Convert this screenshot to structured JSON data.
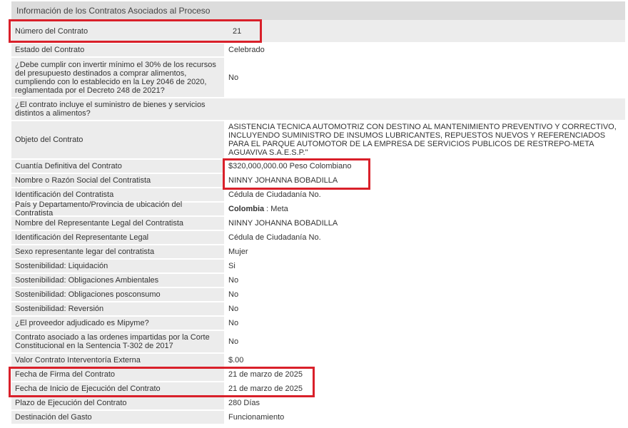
{
  "section_title": "Información de los Contratos Asociados al Proceso",
  "rows": [
    {
      "label": "Número del Contrato",
      "value": "21"
    },
    {
      "label": "Estado del Contrato",
      "value": "Celebrado"
    },
    {
      "label": "¿Debe cumplir con invertir mínimo el 30% de los recursos del presupuesto destinados a comprar alimentos, cumpliendo con lo establecido en la Ley 2046 de 2020, reglamentada por el Decreto 248 de 2021?",
      "value": "No"
    },
    {
      "label": "¿El contrato incluye el suministro de bienes y servicios distintos a alimentos?",
      "value": ""
    },
    {
      "label": "Objeto del Contrato",
      "value": "ASISTENCIA TECNICA AUTOMOTRIZ CON DESTINO AL MANTENIMIENTO PREVENTIVO Y CORRECTIVO, INCLUYENDO SUMINISTRO DE INSUMOS LUBRICANTES, REPUESTOS NUEVOS Y REFERENCIADOS PARA EL PARQUE AUTOMOTOR DE LA EMPRESA DE SERVICIOS PUBLICOS DE RESTREPO-META AGUAVIVA S.A.E.S.P.\""
    },
    {
      "label": "Cuantía Definitiva del Contrato",
      "value": "$320,000,000.00 Peso Colombiano"
    },
    {
      "label": "Nombre o Razón Social del Contratista",
      "value": "NINNY JOHANNA BOBADILLA"
    },
    {
      "label": "Identificación del Contratista",
      "value": "Cédula de Ciudadanía No."
    },
    {
      "label": "País y Departamento/Provincia de ubicación del Contratista",
      "value_bold": "Colombia",
      "value_rest": " : Meta"
    },
    {
      "label": "Nombre del Representante Legal del Contratista",
      "value": "NINNY JOHANNA BOBADILLA"
    },
    {
      "label": "Identificación del Representante Legal",
      "value": "Cédula de Ciudadanía No."
    },
    {
      "label": "Sexo representante legar del contratista",
      "value": "Mujer"
    },
    {
      "label": "Sostenibilidad: Liquidación",
      "value": "Si"
    },
    {
      "label": "Sostenibilidad: Obligaciones Ambientales",
      "value": "No"
    },
    {
      "label": "Sostenibilidad: Obligaciones posconsumo",
      "value": "No"
    },
    {
      "label": "Sostenibilidad: Reversión",
      "value": "No"
    },
    {
      "label": "¿El proveedor adjudicado es Mipyme?",
      "value": "No"
    },
    {
      "label": "Contrato asociado a las ordenes impartidas por la Corte Constitucional en la Sentencia T-302 de 2017",
      "value": "No"
    },
    {
      "label": "Valor Contrato Interventoría Externa",
      "value": "$.00"
    },
    {
      "label": "Fecha de Firma del Contrato",
      "value": "21 de marzo de 2025"
    },
    {
      "label": "Fecha de Inicio de Ejecución del Contrato",
      "value": "21 de marzo de 2025"
    },
    {
      "label": "Plazo de Ejecución del Contrato",
      "value": "280 Días"
    },
    {
      "label": "Destinación del Gasto",
      "value": "Funcionamiento"
    }
  ]
}
